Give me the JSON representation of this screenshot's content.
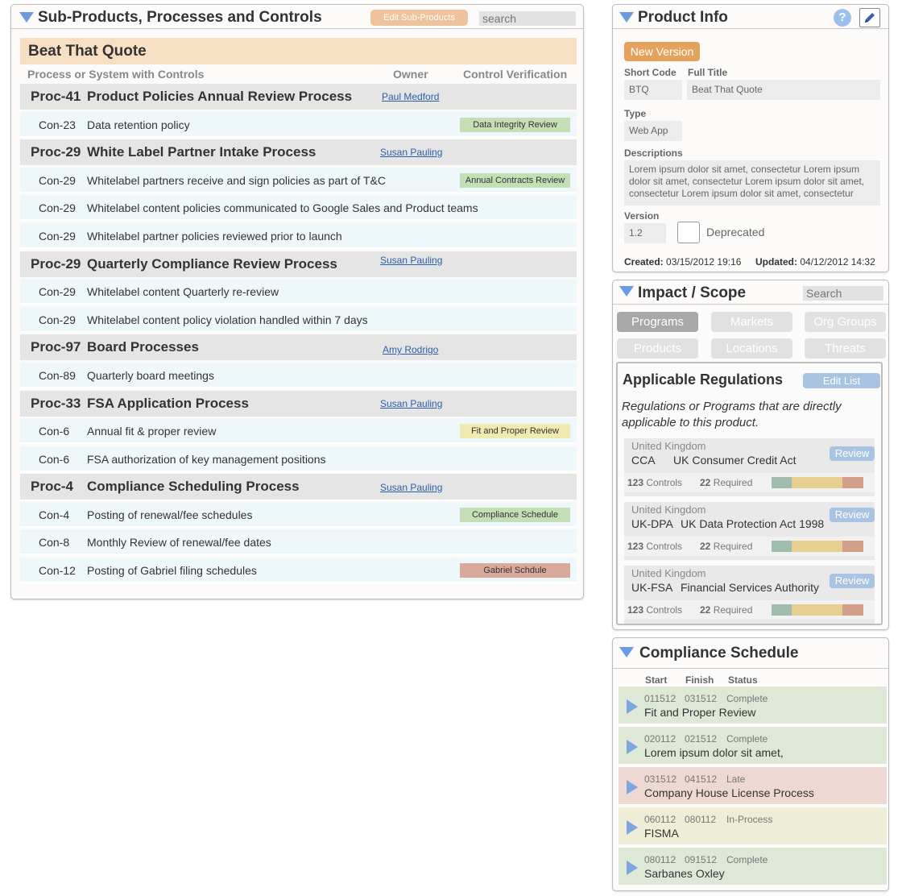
{
  "left_panel": {
    "title": "Sub-Products, Processes and Controls",
    "edit_button": "Edit Sub-Products",
    "search_placeholder": "search",
    "product_name": "Beat That Quote",
    "columns": {
      "process": "Process or System  with Controls",
      "owner": "Owner",
      "verification": "Control Verification"
    },
    "procs": [
      {
        "id": "Proc-41",
        "name": "Product Policies Annual Review Process",
        "owner": "Paul Medford"
      },
      {
        "id": "Proc-29",
        "name": "White Label Partner Intake Process",
        "owner": "Susan Pauling"
      },
      {
        "id": "Proc-29",
        "name": "Quarterly Compliance Review Process",
        "owner": "Susan Pauling"
      },
      {
        "id": "Proc-97",
        "name": "Board Processes",
        "owner": "Amy Rodrigo"
      },
      {
        "id": "Proc-33",
        "name": "FSA Application Process",
        "owner": "Susan Pauling"
      },
      {
        "id": "Proc-4",
        "name": "Compliance Scheduling Process",
        "owner": "Susan Pauling"
      }
    ],
    "controls": [
      {
        "id": "Con-23",
        "name": "Data retention policy",
        "tag": "Data Integrity Review",
        "tag_color": "#c4dfb6"
      },
      {
        "id": "Con-29",
        "name": "Whitelabel partners receive and sign policies as part of T&C",
        "tag": "Annual Contracts Review",
        "tag_color": "#c4dfb6"
      },
      {
        "id": "Con-29",
        "name": "Whitelabel content policies communicated to Google Sales and Product teams"
      },
      {
        "id": "Con-29",
        "name": "Whitelabel partner policies reviewed prior to launch"
      },
      {
        "id": "Con-29",
        "name": "Whitelabel content Quarterly re-review"
      },
      {
        "id": "Con-29",
        "name": "Whitelabel content policy violation handled within 7 days"
      },
      {
        "id": "Con-89",
        "name": "Quarterly board meetings"
      },
      {
        "id": "Con-6",
        "name": "Annual fit & proper review",
        "tag": "Fit and Proper Review",
        "tag_color": "#efeab0"
      },
      {
        "id": "Con-6",
        "name": "FSA authorization of key management positions"
      },
      {
        "id": "Con-4",
        "name": "Posting of renewal/fee schedules",
        "tag": "Compliance Schedule",
        "tag_color": "#c4dfb6"
      },
      {
        "id": "Con-8",
        "name": "Monthly Review of renewal/fee dates"
      },
      {
        "id": "Con-12",
        "name": "Posting of Gabriel filing schedules",
        "tag": "Gabriel Schdule",
        "tag_color": "#d9a99b"
      }
    ]
  },
  "product_info": {
    "title": "Product Info",
    "help": "?",
    "new_version": "New Version",
    "short_code_label": "Short Code",
    "short_code": "BTQ",
    "full_title_label": "Full Title",
    "full_title": "Beat That Quote",
    "type_label": "Type",
    "type": "Web App",
    "descriptions_label": "Descriptions",
    "descriptions": "Lorem ipsum dolor sit amet, consectetur Lorem ipsum dolor sit amet, consectetur Lorem ipsum dolor sit amet, consectetur Lorem ipsum dolor sit amet, consectetur",
    "version_label": "Version",
    "version": "1.2",
    "deprecated": "Deprecated",
    "created_label": "Created:",
    "created": "03/15/2012 19:16",
    "updated_label": "Updated:",
    "updated": "04/12/2012 14:32"
  },
  "impact": {
    "title": "Impact / Scope",
    "search_placeholder": "Search",
    "tabs": [
      "Programs",
      "Markets",
      "Org Groups",
      "Products",
      "Locations",
      "Threats"
    ],
    "regs_title": "Applicable Regulations",
    "edit_list": "Edit List",
    "regs_desc": "Regulations or Programs that are directly applicable to this product.",
    "controls_suffix": "Controls",
    "required_suffix": "Required",
    "review_label": "Review",
    "regulations": [
      {
        "country": "United Kingdom",
        "code": "CCA",
        "name": "UK Consumer Credit Act",
        "controls": "123",
        "required": "22",
        "bar": [
          0.22,
          0.55,
          0.23
        ]
      },
      {
        "country": "United Kingdom",
        "code": "UK-DPA",
        "name": "UK Data Protection Act 1998",
        "controls": "123",
        "required": "22",
        "bar": [
          0.22,
          0.55,
          0.23
        ]
      },
      {
        "country": "United Kingdom",
        "code": "UK-FSA",
        "name": "Financial Services Authority",
        "controls": "123",
        "required": "22",
        "bar": [
          0.22,
          0.55,
          0.23
        ]
      }
    ],
    "bar_colors": [
      "#9fbcae",
      "#e7d08f",
      "#d2a089"
    ]
  },
  "schedule": {
    "title": "Compliance Schedule",
    "headers": {
      "start": "Start",
      "finish": "Finish",
      "status": "Status"
    },
    "items": [
      {
        "start": "011512",
        "finish": "031512",
        "status": "Complete",
        "name": "Fit and Proper Review",
        "color": "#dde9d6"
      },
      {
        "start": "020112",
        "finish": "021512",
        "status": "Complete",
        "name": "Lorem ipsum dolor sit amet,",
        "color": "#dde9d6"
      },
      {
        "start": "031512",
        "finish": "041512",
        "status": "Late",
        "name": "Company House License Process",
        "color": "#eed8d3"
      },
      {
        "start": "060112",
        "finish": "080112",
        "status": "In-Process",
        "name": "FISMA",
        "color": "#eeedd8"
      },
      {
        "start": "080112",
        "finish": "091512",
        "status": "Complete",
        "name": "Sarbanes Oxley",
        "color": "#dde9d6"
      }
    ]
  }
}
